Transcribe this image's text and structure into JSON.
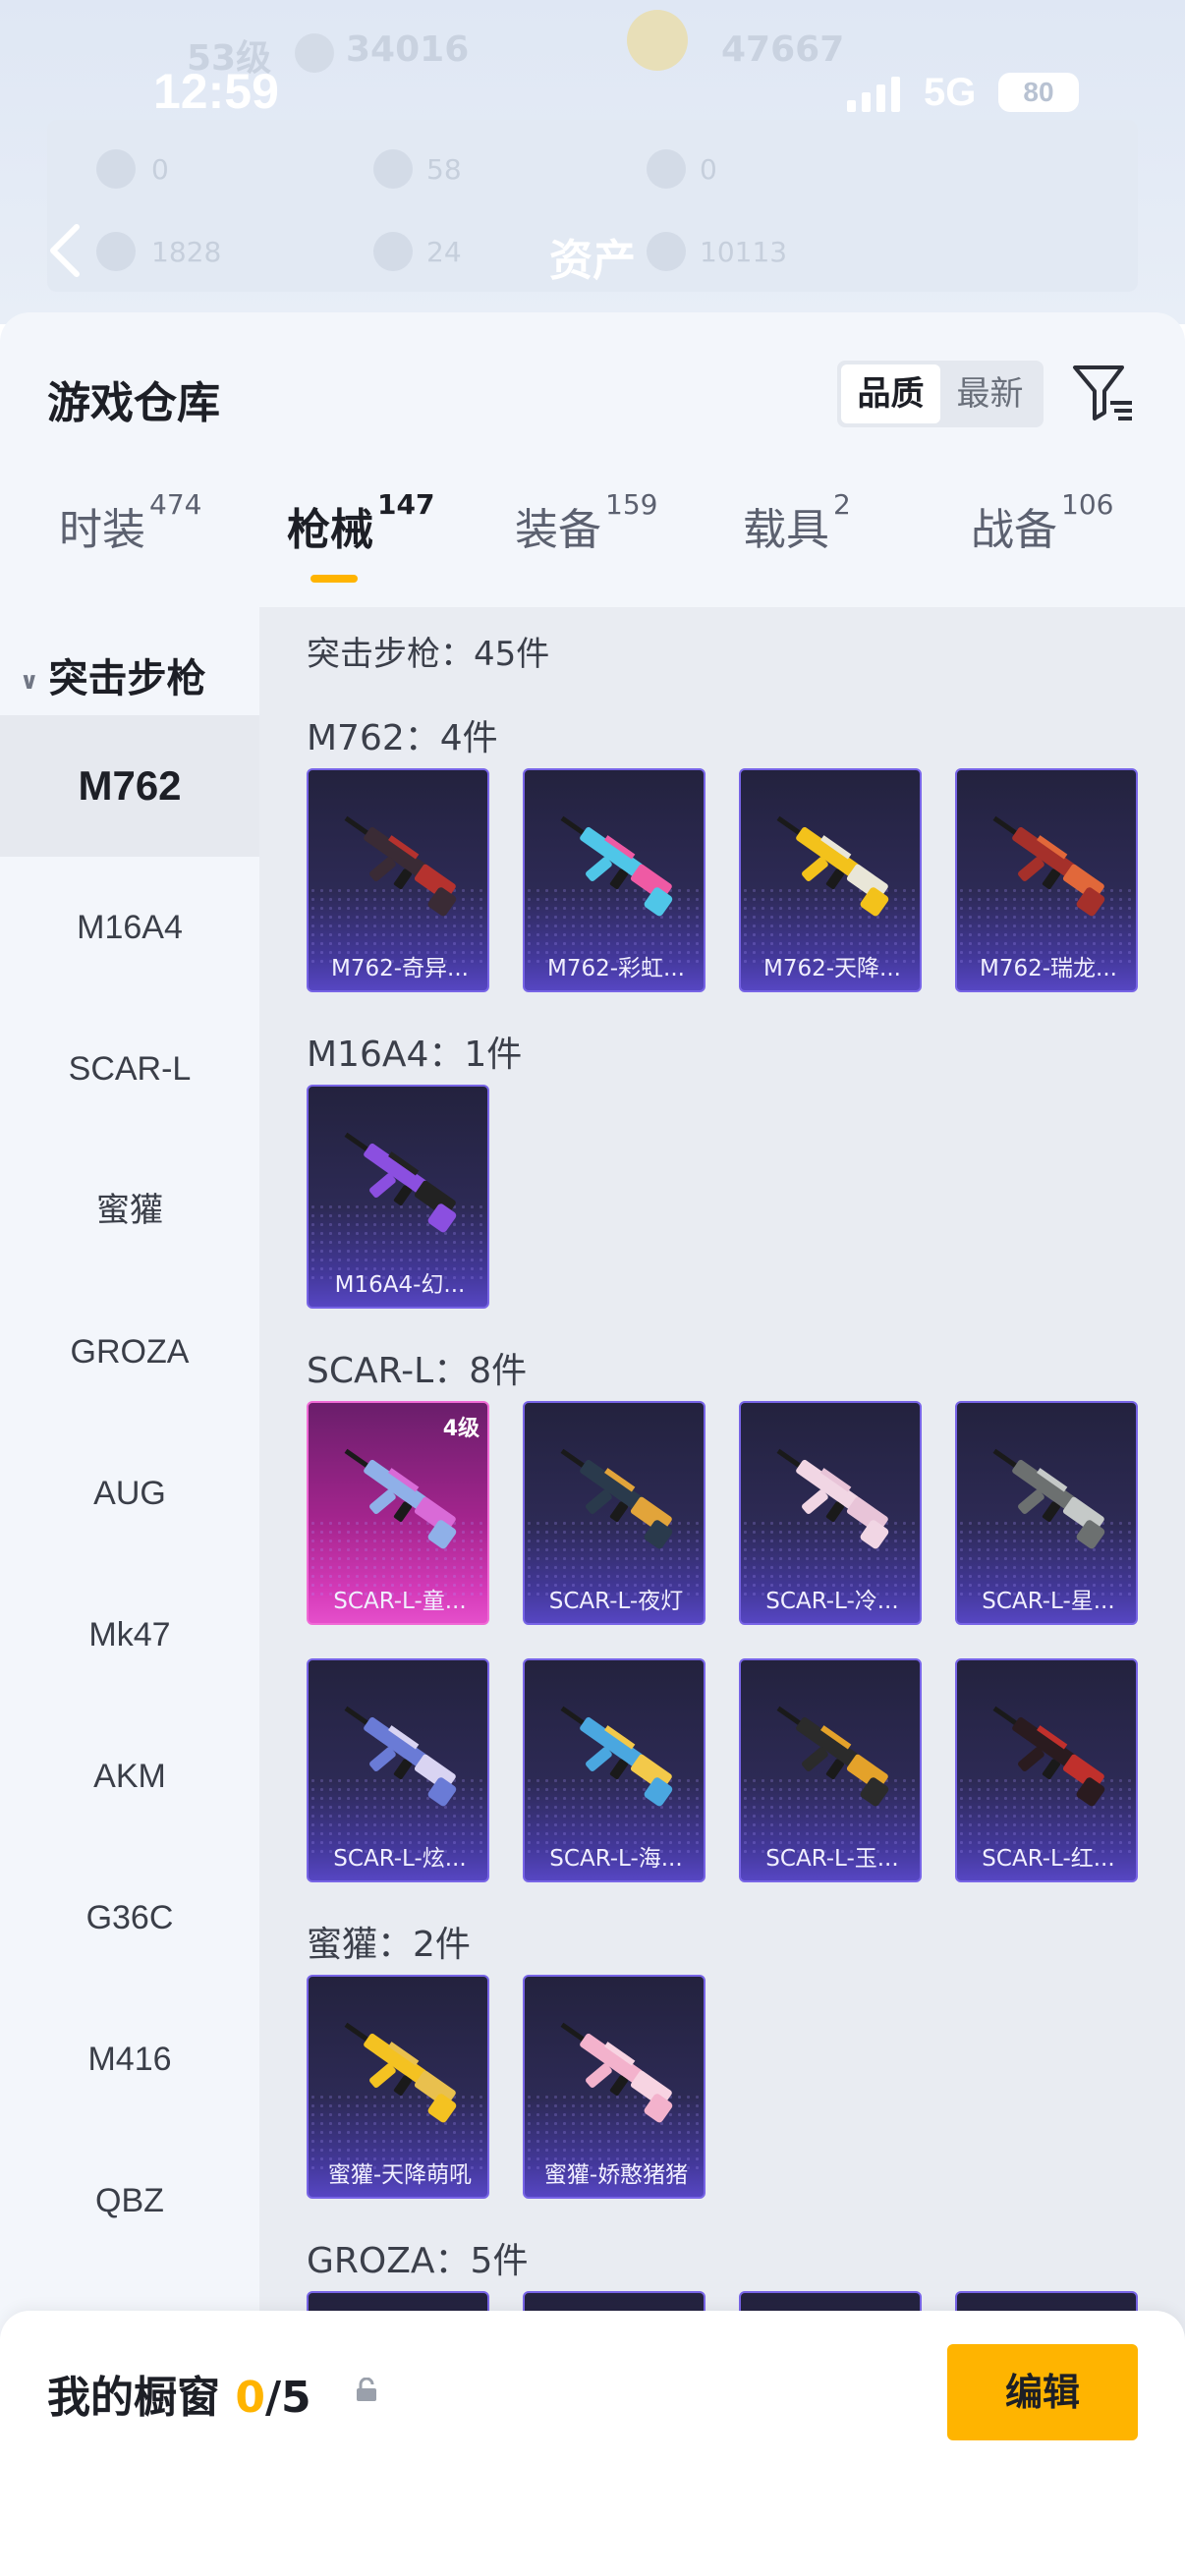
{
  "status_bar": {
    "time": "12:59",
    "network": "5G",
    "battery": "80"
  },
  "header": {
    "title": "资产",
    "bg_stats": [
      "53级",
      "34016",
      "47667",
      "0",
      "58",
      "0",
      "1828",
      "24",
      "10113"
    ]
  },
  "panel": {
    "title": "游戏仓库",
    "sort": {
      "quality": "品质",
      "newest": "最新"
    }
  },
  "tabs": [
    {
      "label": "时装",
      "count": "474"
    },
    {
      "label": "枪械",
      "count": "147",
      "active": true
    },
    {
      "label": "装备",
      "count": "159"
    },
    {
      "label": "载具",
      "count": "2"
    },
    {
      "label": "战备",
      "count": "106"
    }
  ],
  "sidebar": {
    "category": "突击步枪",
    "items": [
      "M762",
      "M16A4",
      "SCAR-L",
      "蜜獾",
      "GROZA",
      "AUG",
      "Mk47",
      "AKM",
      "G36C",
      "M416",
      "QBZ"
    ]
  },
  "content": {
    "category_summary": "突击步枪：45件",
    "groups": [
      {
        "heading": "M762：4件",
        "items": [
          {
            "label": "M762-奇异...",
            "colors": [
              "#3a2b35",
              "#b5322e"
            ]
          },
          {
            "label": "M762-彩虹...",
            "colors": [
              "#4fc6e8",
              "#ef5aa4"
            ]
          },
          {
            "label": "M762-天降...",
            "colors": [
              "#f3c21b",
              "#e9e6d8"
            ]
          },
          {
            "label": "M762-瑞龙...",
            "colors": [
              "#a5302a",
              "#e1683a"
            ]
          }
        ]
      },
      {
        "heading": "M16A4：1件",
        "items": [
          {
            "label": "M16A4-幻...",
            "colors": [
              "#8b4fe0",
              "#222222"
            ]
          }
        ]
      },
      {
        "heading": "SCAR-L：8件",
        "items": [
          {
            "label": "SCAR-L-童...",
            "colors": [
              "#8fb0e8",
              "#d96ad7"
            ],
            "level": "4级",
            "rarity": "pink"
          },
          {
            "label": "SCAR-L-夜灯",
            "colors": [
              "#2a3a4c",
              "#e2a43a"
            ]
          },
          {
            "label": "SCAR-L-冷...",
            "colors": [
              "#f1d6e4",
              "#e8c4d8"
            ]
          },
          {
            "label": "SCAR-L-星...",
            "colors": [
              "#6c7070",
              "#c5c9c8"
            ]
          },
          {
            "label": "SCAR-L-炫...",
            "colors": [
              "#6a7bd6",
              "#d9d4f2"
            ]
          },
          {
            "label": "SCAR-L-海...",
            "colors": [
              "#4aa7e0",
              "#f3c94a"
            ]
          },
          {
            "label": "SCAR-L-玉...",
            "colors": [
              "#2b2b2b",
              "#e4a22a"
            ]
          },
          {
            "label": "SCAR-L-红...",
            "colors": [
              "#2a1b1f",
              "#c0302c"
            ]
          }
        ]
      },
      {
        "heading": "蜜獾：2件",
        "items": [
          {
            "label": "蜜獾-天降萌吼",
            "colors": [
              "#f4c221",
              "#e9c04e"
            ]
          },
          {
            "label": "蜜獾-娇憨猪猪",
            "colors": [
              "#f3b2cc",
              "#f7d4e2"
            ]
          }
        ]
      },
      {
        "heading": "GROZA：5件",
        "items": []
      }
    ]
  },
  "bottom": {
    "showcase_label": "我的橱窗",
    "showcase_count": "0",
    "showcase_total": "/5",
    "edit_label": "编辑"
  },
  "colors": {
    "accent": "#ffb400",
    "card_purple": "#5646c2",
    "card_pink": "#e54fcb"
  }
}
